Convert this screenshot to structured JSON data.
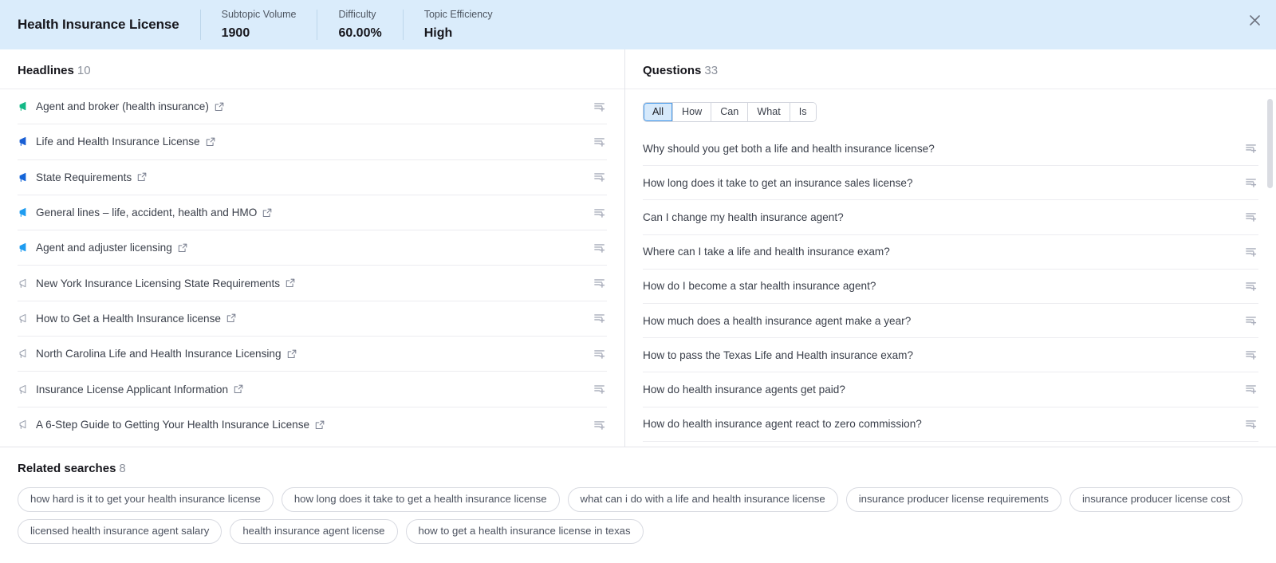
{
  "header": {
    "title": "Health Insurance License",
    "metrics": [
      {
        "label": "Subtopic Volume",
        "value": "1900"
      },
      {
        "label": "Difficulty",
        "value": "60.00%"
      },
      {
        "label": "Topic Efficiency",
        "value": "High"
      }
    ],
    "close_icon": "close-icon"
  },
  "headlines": {
    "title": "Headlines",
    "count": "10",
    "items": [
      {
        "text": "Agent and broker (health insurance)",
        "icon": "megaphone-icon",
        "color": "#12b886",
        "style": "solid"
      },
      {
        "text": "Life and Health Insurance License",
        "icon": "megaphone-icon",
        "color": "#1a5fd4",
        "style": "solid"
      },
      {
        "text": "State Requirements",
        "icon": "megaphone-icon",
        "color": "#1565d8",
        "style": "solid"
      },
      {
        "text": "General lines – life, accident, health and HMO",
        "icon": "megaphone-icon",
        "color": "#1f9cf0",
        "style": "solid"
      },
      {
        "text": "Agent and adjuster licensing",
        "icon": "megaphone-icon",
        "color": "#1f9cf0",
        "style": "solid"
      },
      {
        "text": "New York Insurance Licensing State Requirements",
        "icon": "megaphone-icon",
        "color": "#9aa0ae",
        "style": "outline"
      },
      {
        "text": "How to Get a Health Insurance license",
        "icon": "megaphone-icon",
        "color": "#9aa0ae",
        "style": "outline"
      },
      {
        "text": "North Carolina Life and Health Insurance Licensing",
        "icon": "megaphone-icon",
        "color": "#9aa0ae",
        "style": "outline"
      },
      {
        "text": "Insurance License Applicant Information",
        "icon": "megaphone-icon",
        "color": "#9aa0ae",
        "style": "outline"
      },
      {
        "text": "A 6-Step Guide to Getting Your Health Insurance License",
        "icon": "megaphone-icon",
        "color": "#9aa0ae",
        "style": "outline"
      }
    ],
    "row_external_icon": "external-link-icon",
    "row_action_icon": "add-to-list-icon"
  },
  "questions": {
    "title": "Questions",
    "count": "33",
    "filters": [
      {
        "label": "All",
        "active": true
      },
      {
        "label": "How",
        "active": false
      },
      {
        "label": "Can",
        "active": false
      },
      {
        "label": "What",
        "active": false
      },
      {
        "label": "Is",
        "active": false
      }
    ],
    "items": [
      "Why should you get both a life and health insurance license?",
      "How long does it take to get an insurance sales license?",
      "Can I change my health insurance agent?",
      "Where can I take a life and health insurance exam?",
      "How do I become a star health insurance agent?",
      "How much does a health insurance agent make a year?",
      "How to pass the Texas Life and Health insurance exam?",
      "How do health insurance agents get paid?",
      "How do health insurance agent react to zero commission?"
    ],
    "row_action_icon": "add-to-list-icon"
  },
  "related": {
    "title": "Related searches",
    "count": "8",
    "items": [
      "how hard is it to get your health insurance license",
      "how long does it take to get a health insurance license",
      "what can i do with a life and health insurance license",
      "insurance producer license requirements",
      "insurance producer license cost",
      "licensed health insurance agent salary",
      "health insurance agent license",
      "how to get a health insurance license in texas"
    ]
  },
  "colors": {
    "header_bg": "#daecfb",
    "accent": "#1f9cf0",
    "active_filter_bg": "#d6e9fb"
  }
}
